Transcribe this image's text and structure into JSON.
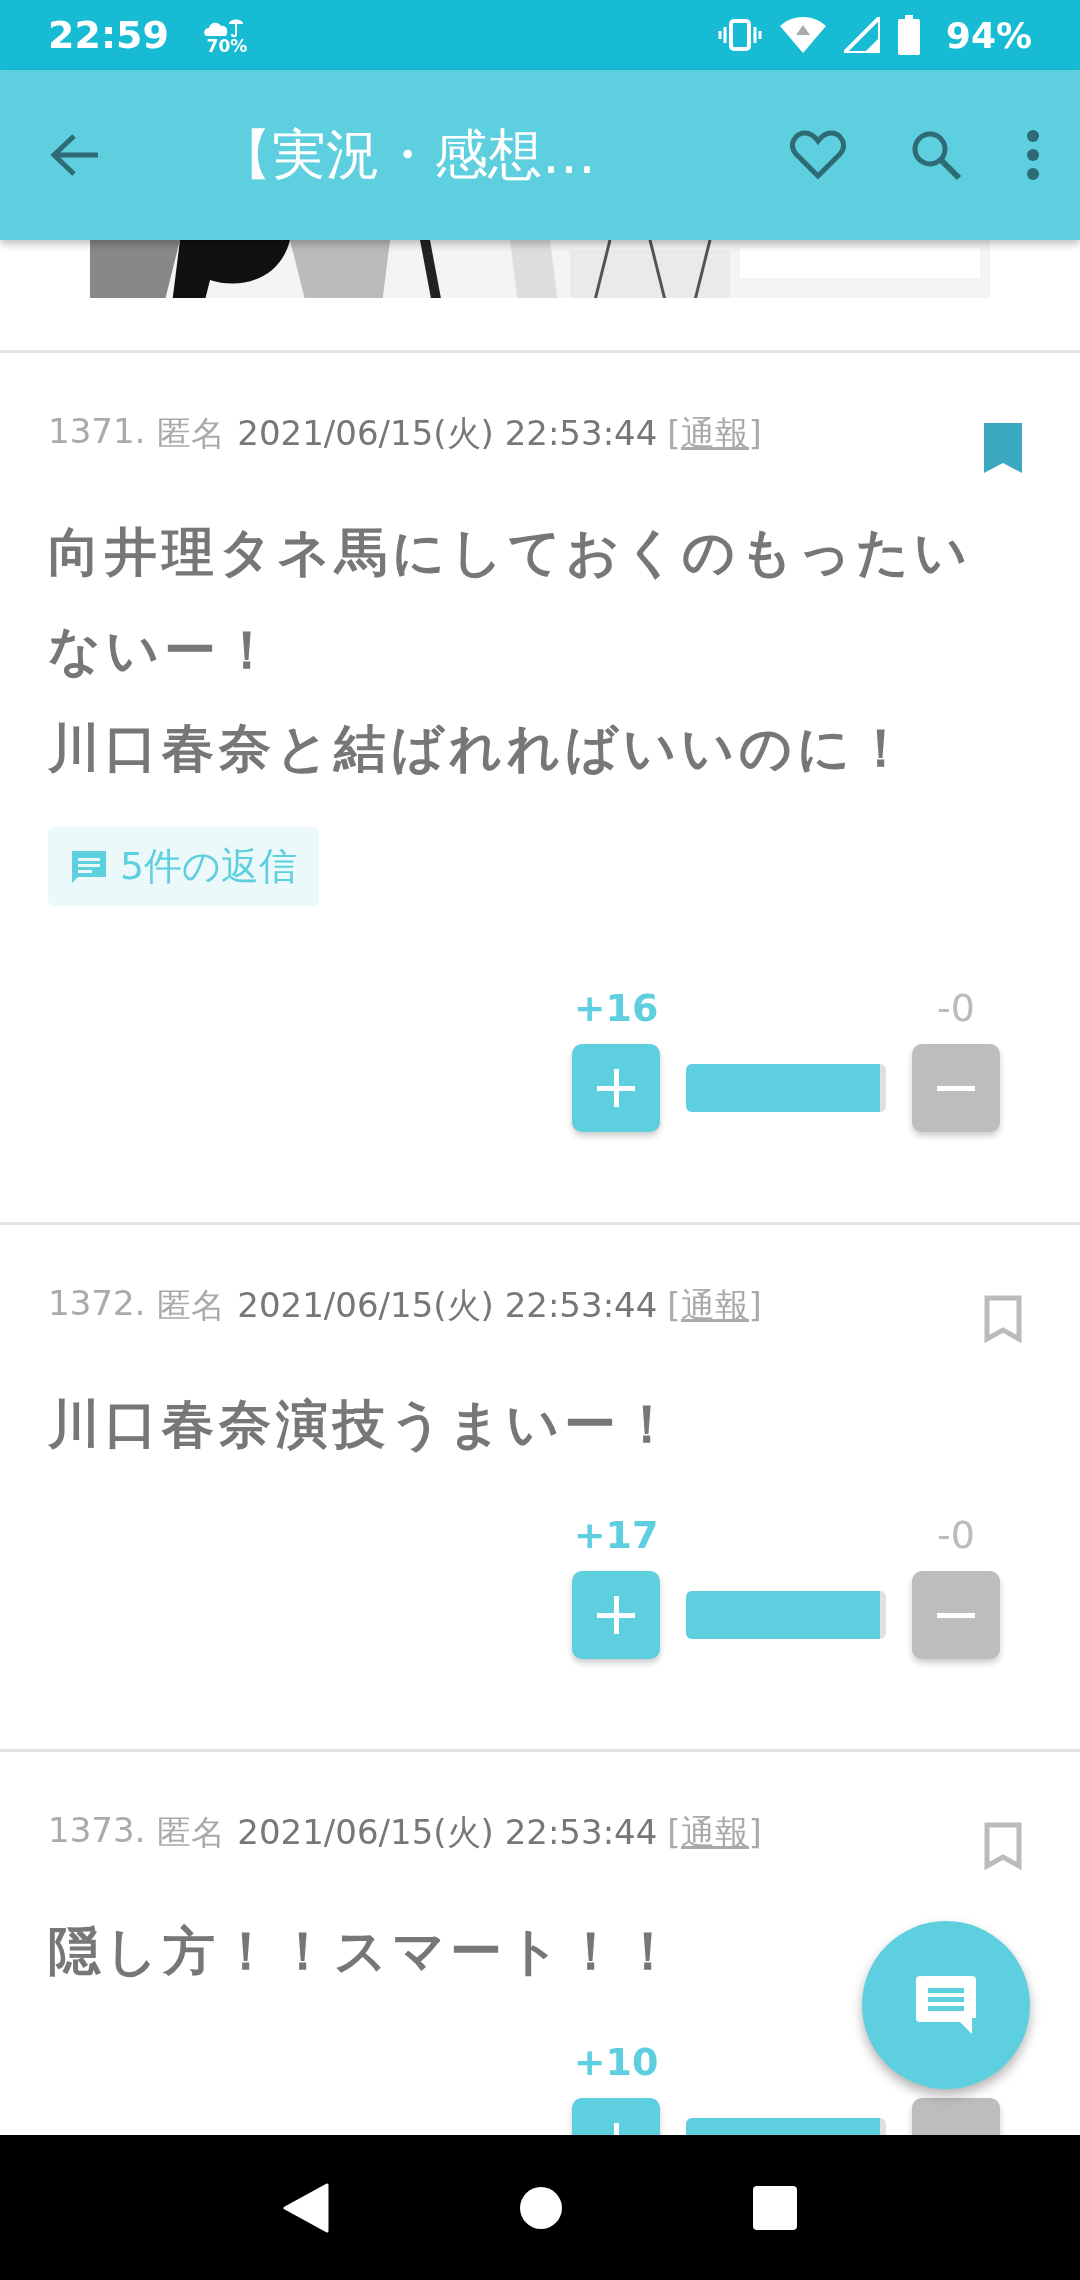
{
  "status_bar": {
    "time": "22:59",
    "weather_percent": "70%",
    "battery": "94%"
  },
  "app_bar": {
    "title": "【実況・感想…"
  },
  "posts": [
    {
      "number": "1371.",
      "author": "匿名",
      "date": "2021/06/15(火) 22:53:44",
      "report": "[通報]",
      "bookmarked": true,
      "body": [
        "向井理タネ馬にしておくのもったいないー！",
        "川口春奈と結ばれればいいのに！"
      ],
      "replies": "5件の返信",
      "plus": "+16",
      "minus": "-0",
      "level": 0.97
    },
    {
      "number": "1372.",
      "author": "匿名",
      "date": "2021/06/15(火) 22:53:44",
      "report": "[通報]",
      "bookmarked": false,
      "body": [
        "川口春奈演技うまいー！"
      ],
      "plus": "+17",
      "minus": "-0",
      "level": 0.97
    },
    {
      "number": "1373.",
      "author": "匿名",
      "date": "2021/06/15(火) 22:53:44",
      "report": "[通報]",
      "bookmarked": false,
      "body": [
        "隠し方！！スマート！！"
      ],
      "plus": "+10",
      "level": 0.97
    }
  ]
}
